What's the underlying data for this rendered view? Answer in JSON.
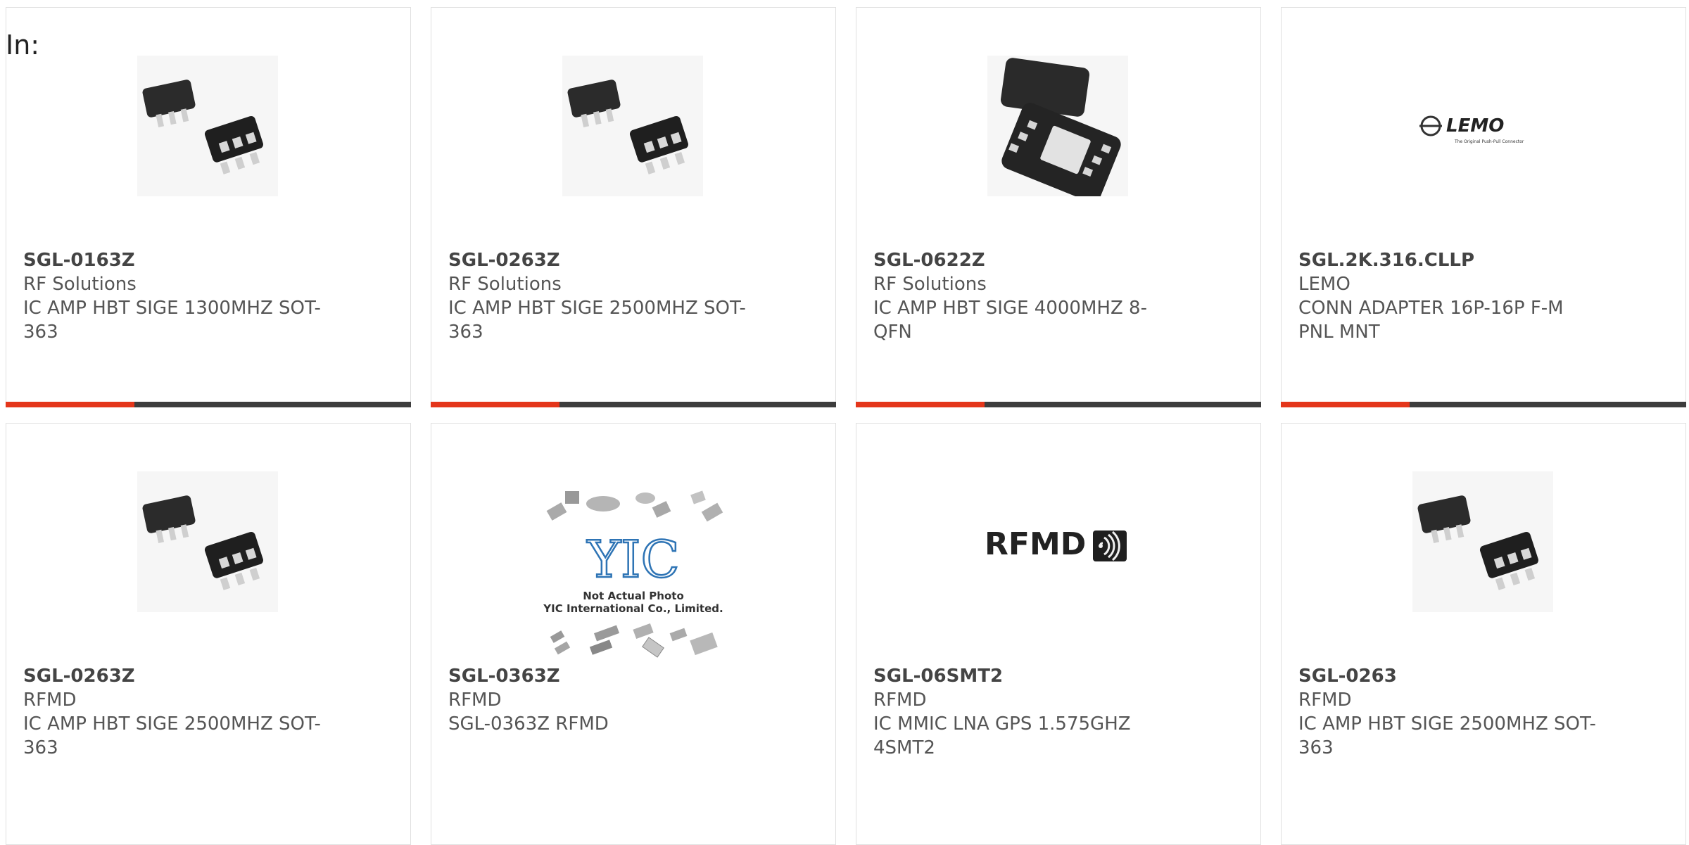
{
  "filter": {
    "label": "In:"
  },
  "products": [
    {
      "part": "SGL-0163Z",
      "manufacturer": "RF Solutions",
      "description": "IC AMP HBT SIGE 1300MHZ SOT-363",
      "image_icon": "sot363-chip-icon"
    },
    {
      "part": "SGL-0263Z",
      "manufacturer": "RF Solutions",
      "description": "IC AMP HBT SIGE 2500MHZ SOT-363",
      "image_icon": "sot363-chip-icon"
    },
    {
      "part": "SGL-0622Z",
      "manufacturer": "RF Solutions",
      "description": "IC AMP HBT SIGE 4000MHZ 8-QFN",
      "image_icon": "qfn-chip-icon"
    },
    {
      "part": "SGL.2K.316.CLLP",
      "manufacturer": "LEMO",
      "description": "CONN ADAPTER 16P-16P F-M PNL MNT",
      "image_icon": "lemo-logo",
      "logo_text": "LEMO",
      "logo_tagline": "The Original Push-Pull Connector"
    },
    {
      "part": "SGL-0263Z",
      "manufacturer": "RFMD",
      "description": "IC AMP HBT SIGE 2500MHZ SOT-363",
      "image_icon": "sot363-chip-icon"
    },
    {
      "part": "SGL-0363Z",
      "manufacturer": "RFMD",
      "description": "SGL-0363Z RFMD",
      "image_icon": "yic-placeholder-image",
      "placeholder_line1": "Not Actual Photo",
      "placeholder_line2": "YIC International Co., Limited.",
      "placeholder_logo": "YIC"
    },
    {
      "part": "SGL-06SMT2",
      "manufacturer": "RFMD",
      "description": "IC MMIC LNA GPS 1.575GHZ 4SMT2",
      "image_icon": "rfmd-logo",
      "logo_text": "RFMD"
    },
    {
      "part": "SGL-0263",
      "manufacturer": "RFMD",
      "description": "IC AMP HBT SIGE 2500MHZ SOT-363",
      "image_icon": "sot363-chip-icon"
    }
  ],
  "colors": {
    "accent": "#e4361b",
    "bar": "#3d3d3d",
    "border": "#e0e0e0"
  }
}
